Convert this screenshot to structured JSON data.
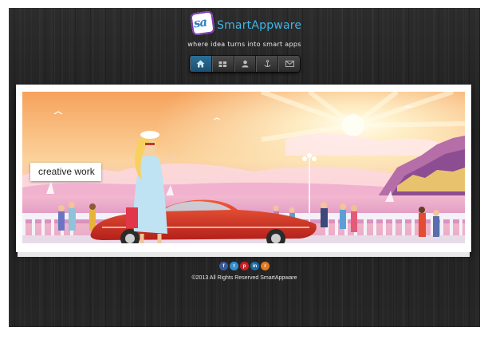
{
  "header": {
    "logo_mark": "sa",
    "logo_text": "SmartAppware",
    "tagline": "where idea turns into smart apps"
  },
  "nav": {
    "items": [
      {
        "icon": "home-icon",
        "active": true
      },
      {
        "icon": "services-icon",
        "active": false
      },
      {
        "icon": "user-icon",
        "active": false
      },
      {
        "icon": "anchor-icon",
        "active": false
      },
      {
        "icon": "mail-icon",
        "active": false
      }
    ]
  },
  "banner": {
    "caption": "creative work"
  },
  "social": [
    {
      "icon": "facebook-icon",
      "glyph": "f",
      "color": "#3b5998"
    },
    {
      "icon": "twitter-icon",
      "glyph": "t",
      "color": "#2f8fd1"
    },
    {
      "icon": "pinterest-icon",
      "glyph": "p",
      "color": "#cb2027"
    },
    {
      "icon": "linkedin-icon",
      "glyph": "in",
      "color": "#1c6aa3"
    },
    {
      "icon": "rss-icon",
      "glyph": "r",
      "color": "#e07b20"
    }
  ],
  "footer": {
    "copyright": "©2013 All Rights Reserved SmartAppware"
  },
  "colors": {
    "accent": "#3fb5e6",
    "nav_active": "#2b6f96"
  }
}
